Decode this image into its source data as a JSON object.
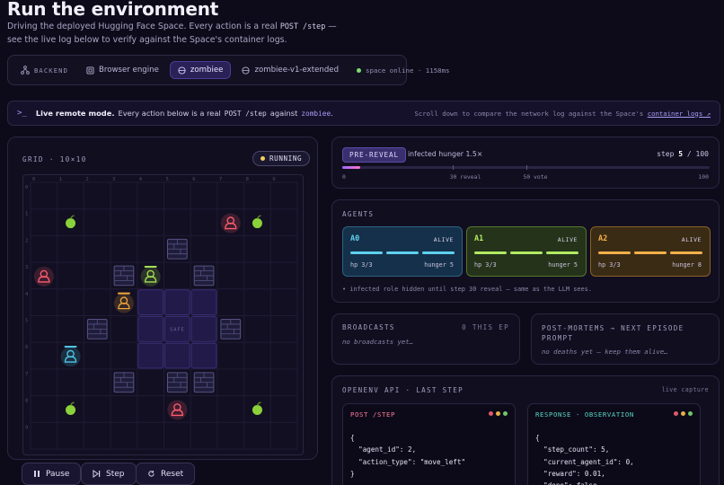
{
  "header": {
    "title": "Run the environment",
    "subtitle_pre": "Driving the deployed Hugging Face Space. Every action is a real",
    "subtitle_code": "POST /step",
    "subtitle_post": "— see the live log below to verify against the Space's container logs."
  },
  "backend_bar": {
    "label": "BACKEND",
    "options": [
      {
        "label": "Browser engine",
        "icon": "browser-icon",
        "active": false
      },
      {
        "label": "zombiee",
        "icon": "globe-icon",
        "active": true
      },
      {
        "label": "zombiee-v1-extended",
        "icon": "globe-icon",
        "active": false
      }
    ],
    "status": "space online · 1158ms",
    "status_color": "#7ddc6e"
  },
  "remote_bar": {
    "title": "Live remote mode.",
    "text_pre": "Every action below is a real",
    "code": "POST /step",
    "text_mid": "against",
    "target": "zombiee",
    "text_end": ".",
    "right_text": "Scroll down to compare the network log against the Space's",
    "right_link": "container logs ↗"
  },
  "grid_panel": {
    "label": "GRID · 10×10",
    "state": "RUNNING",
    "safe_label": "SAFE",
    "col_labels": [
      "0",
      "1",
      "2",
      "3",
      "4",
      "5",
      "6",
      "7",
      "8",
      "9"
    ],
    "row_labels": [
      "0",
      "1",
      "2",
      "3",
      "4",
      "5",
      "6",
      "7",
      "8",
      "9"
    ],
    "size": 10,
    "walls": [
      [
        5,
        2
      ],
      [
        3,
        3
      ],
      [
        6,
        3
      ],
      [
        2,
        5
      ],
      [
        7,
        5
      ],
      [
        3,
        7
      ],
      [
        5,
        7
      ],
      [
        6,
        7
      ]
    ],
    "safe_zone": [
      [
        4,
        4
      ],
      [
        5,
        4
      ],
      [
        6,
        4
      ],
      [
        4,
        5
      ],
      [
        5,
        5
      ],
      [
        6,
        5
      ],
      [
        4,
        6
      ],
      [
        5,
        6
      ],
      [
        6,
        6
      ]
    ],
    "food": [
      [
        1,
        1
      ],
      [
        8,
        1
      ],
      [
        1,
        8
      ],
      [
        8,
        8
      ]
    ],
    "zombies": [
      [
        7,
        1
      ],
      [
        0,
        3
      ],
      [
        5,
        8
      ]
    ],
    "agents": [
      {
        "id": "A0",
        "pos": [
          1,
          6
        ],
        "color": "#4fc6e6"
      },
      {
        "id": "A1",
        "pos": [
          4,
          3
        ],
        "color": "#a4e054"
      },
      {
        "id": "A2",
        "pos": [
          3,
          4
        ],
        "color": "#f0a63c"
      }
    ],
    "controls": {
      "pause": "Pause",
      "step": "Step",
      "reset": "Reset"
    }
  },
  "status_panel": {
    "badge": "PRE-REVEAL",
    "note": "infected hunger 1.5×",
    "step_prefix": "step",
    "step_current": "5",
    "step_sep": "/",
    "step_total": "100",
    "progress_fraction": 0.05,
    "ticks": [
      {
        "label": "0",
        "value": 0
      },
      {
        "label": "30 reveal",
        "value": 30
      },
      {
        "label": "50 vote",
        "value": 50
      },
      {
        "label": "100",
        "value": 100
      }
    ]
  },
  "agents_panel": {
    "label": "AGENTS",
    "agents": [
      {
        "id": "A0",
        "status": "ALIVE",
        "hp": "hp 3/3",
        "hunger": "hunger 5",
        "color": "#5fd0ee",
        "bg": "#15304a",
        "border": "#2d6480"
      },
      {
        "id": "A1",
        "status": "ALIVE",
        "hp": "hp 3/3",
        "hunger": "hunger 5",
        "color": "#b2ea62",
        "bg": "#24331a",
        "border": "#55772a"
      },
      {
        "id": "A2",
        "status": "ALIVE",
        "hp": "hp 3/3",
        "hunger": "hunger 8",
        "color": "#f5b04a",
        "bg": "#3a2b15",
        "border": "#8a6226"
      }
    ],
    "note": "• infected role hidden until step 30 reveal — same as the LLM sees."
  },
  "broadcasts": {
    "label": "BROADCASTS",
    "count": "0 THIS EP",
    "empty": "no broadcasts yet…"
  },
  "postmortems": {
    "label": "POST-MORTEMS → NEXT EPISODE PROMPT",
    "empty": "no deaths yet — keep them alive…"
  },
  "api_panel": {
    "label": "OPENENV API · LAST STEP",
    "capture": "live capture",
    "request": {
      "title": "POST /STEP",
      "lines": [
        "{",
        "  \"agent_id\": 2,",
        "  \"action_type\": \"move_left\"",
        "}"
      ]
    },
    "response": {
      "title": "RESPONSE · OBSERVATION",
      "lines": [
        "{",
        "  \"step_count\": 5,",
        "  \"current_agent_id\": 0,",
        "  \"reward\": 0.01,",
        "  \"done\": false,"
      ]
    }
  }
}
